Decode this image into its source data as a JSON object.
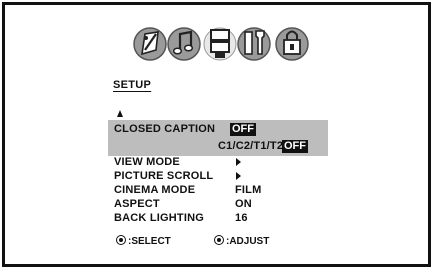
{
  "menu": {
    "title": "SETUP",
    "icons": [
      "picture-icon",
      "audio-icon",
      "setup-icon",
      "tools-icon",
      "lock-icon"
    ],
    "closed_caption": {
      "label": "CLOSED CAPTION",
      "value": "OFF",
      "sub_options": "C1/C2/T1/T2/",
      "sub_value": "OFF"
    },
    "items": [
      {
        "label": "VIEW MODE",
        "value": ""
      },
      {
        "label": "PICTURE SCROLL",
        "value": ""
      },
      {
        "label": "CINEMA MODE",
        "value": "FILM"
      },
      {
        "label": "ASPECT",
        "value": "ON"
      },
      {
        "label": "BACK LIGHTING",
        "value": "16"
      }
    ]
  },
  "footer": {
    "select_label": ":SELECT",
    "adjust_label": ":ADJUST"
  }
}
